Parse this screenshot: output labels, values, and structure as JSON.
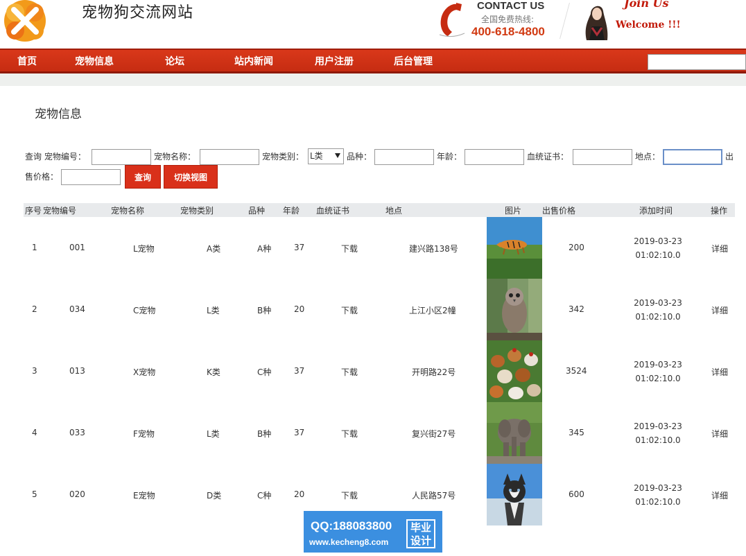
{
  "site": {
    "title": "宠物狗交流网站",
    "contact_title": "CONTACT US",
    "contact_sub": "全国免费热线:",
    "contact_phone": "400-618-4800",
    "join_title": "Join Us",
    "join_sub": "Welcome !!!"
  },
  "nav": {
    "items": [
      "首页",
      "宠物信息",
      "论坛",
      "站内新闻",
      "用户注册",
      "后台管理"
    ],
    "search_value": ""
  },
  "page": {
    "title": "宠物信息"
  },
  "search": {
    "lbl_query_id": "查询 宠物编号：",
    "lbl_name": "宠物名称：",
    "lbl_category": "宠物类别：",
    "category_selected": "L类",
    "lbl_breed": "品种：",
    "lbl_age": "年龄：",
    "lbl_pedigree": "血统证书：",
    "lbl_location": "地点：",
    "lbl_price_a": "出",
    "lbl_price_b": "售价格：",
    "btn_query": "查询",
    "btn_switch": "切换视图"
  },
  "table": {
    "headers": [
      "序号",
      "宠物编号",
      "宠物名称",
      "宠物类别",
      "品种",
      "年龄",
      "血统证书",
      "地点",
      "图片",
      "出售价格",
      "添加时间",
      "操作"
    ],
    "rows": [
      {
        "no": "1",
        "id": "001",
        "name": "L宠物",
        "category": "A类",
        "breed": "A种",
        "age": "37",
        "pedigree": "下载",
        "location": "建兴路138号",
        "photo": "tiger-photo",
        "price": "200",
        "date": "2019-03-23",
        "time": "01:02:10.0",
        "action": "详细"
      },
      {
        "no": "2",
        "id": "034",
        "name": "C宠物",
        "category": "L类",
        "breed": "B种",
        "age": "20",
        "pedigree": "下载",
        "location": "上江小区2幢",
        "photo": "owl-photo",
        "price": "342",
        "date": "2019-03-23",
        "time": "01:02:10.0",
        "action": "详细"
      },
      {
        "no": "3",
        "id": "013",
        "name": "X宠物",
        "category": "K类",
        "breed": "C种",
        "age": "37",
        "pedigree": "下载",
        "location": "开明路22号",
        "photo": "chickens-photo",
        "price": "3524",
        "date": "2019-03-23",
        "time": "01:02:10.0",
        "action": "详细"
      },
      {
        "no": "4",
        "id": "033",
        "name": "F宠物",
        "category": "L类",
        "breed": "B种",
        "age": "37",
        "pedigree": "下载",
        "location": "复兴街27号",
        "photo": "elephant-photo",
        "price": "345",
        "date": "2019-03-23",
        "time": "01:02:10.0",
        "action": "详细"
      },
      {
        "no": "5",
        "id": "020",
        "name": "E宠物",
        "category": "D类",
        "breed": "C种",
        "age": "20",
        "pedigree": "下载",
        "location": "人民路57号",
        "photo": "husky-photo",
        "price": "600",
        "date": "2019-03-23",
        "time": "01:02:10.0",
        "action": "详细"
      }
    ]
  },
  "watermark": {
    "qq": "QQ:188083800",
    "url": "www.kecheng8.com",
    "badge_a": "毕业",
    "badge_b": "设计"
  },
  "colors": {
    "brand_red": "#d9381a",
    "header_bg": "#e8eaec",
    "watermark_blue": "#3b8fe0"
  }
}
